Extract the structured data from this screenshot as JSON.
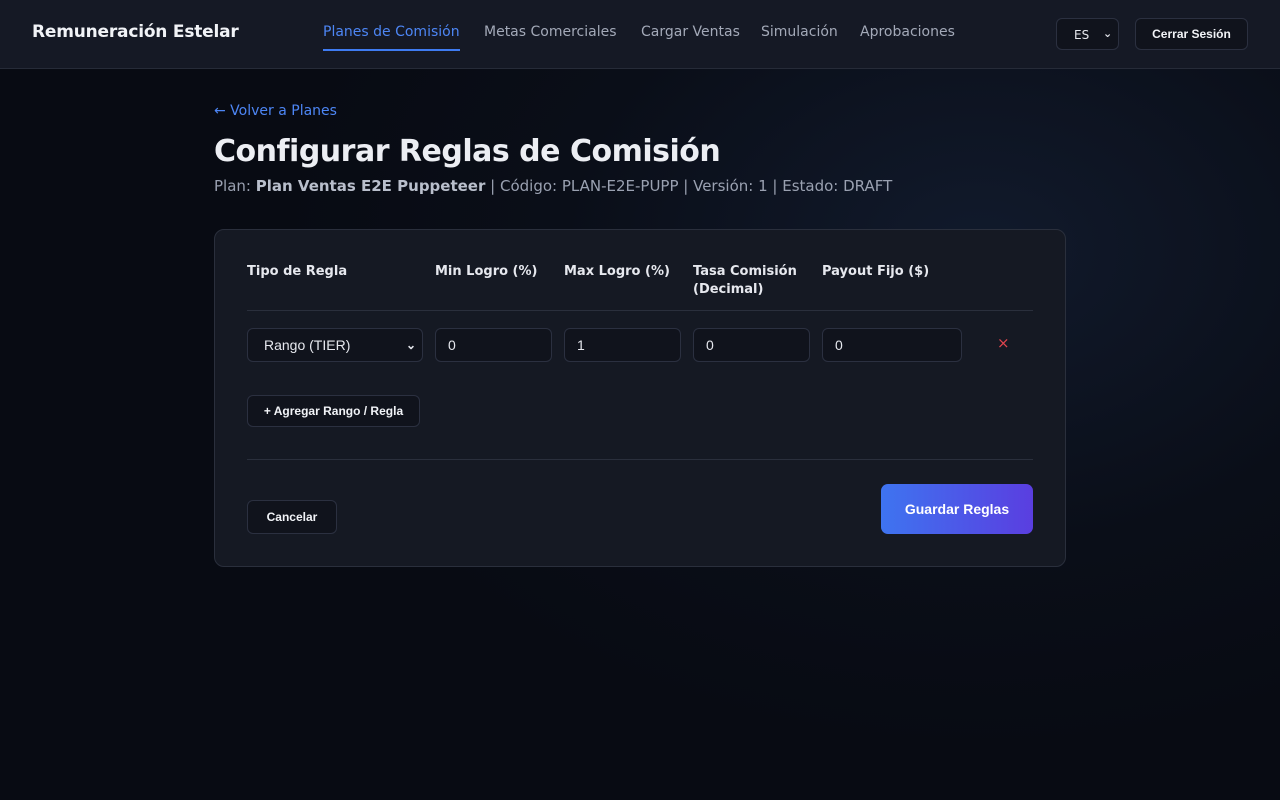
{
  "header": {
    "brand": "Remuneración Estelar",
    "nav": [
      {
        "label": "Planes de Comisión",
        "active": true
      },
      {
        "label": "Metas Comerciales"
      },
      {
        "label": "Cargar Ventas"
      },
      {
        "label": "Simulación"
      },
      {
        "label": "Aprobaciones"
      }
    ],
    "language": "ES",
    "logout_label": "Cerrar Sesión"
  },
  "page": {
    "back_label": "← Volver a Planes",
    "title": "Configurar Reglas de Comisión",
    "meta": {
      "plan_prefix": "Plan:",
      "plan_name": "Plan Ventas E2E Puppeteer",
      "rest": "| Código: PLAN-E2E-PUPP | Versión: 1 | Estado: DRAFT"
    }
  },
  "rules_table": {
    "columns": [
      "Tipo de Regla",
      "Min Logro (%)",
      "Max Logro (%)",
      "Tasa Comisión (Decimal)",
      "Payout Fijo ($)"
    ],
    "rows": [
      {
        "rule_type": "Rango (TIER)",
        "min": "0",
        "max": "1",
        "rate": "0",
        "payout": "0",
        "remove_symbol": "×"
      }
    ],
    "add_label": "+ Agregar Rango / Regla"
  },
  "actions": {
    "cancel_label": "Cancelar",
    "save_label": "Guardar Reglas"
  },
  "colors": {
    "accent": "#3e7bf2",
    "danger": "#e0454e",
    "save_gradient_start": "#3e74f0",
    "save_gradient_end": "#5a3ee0"
  }
}
